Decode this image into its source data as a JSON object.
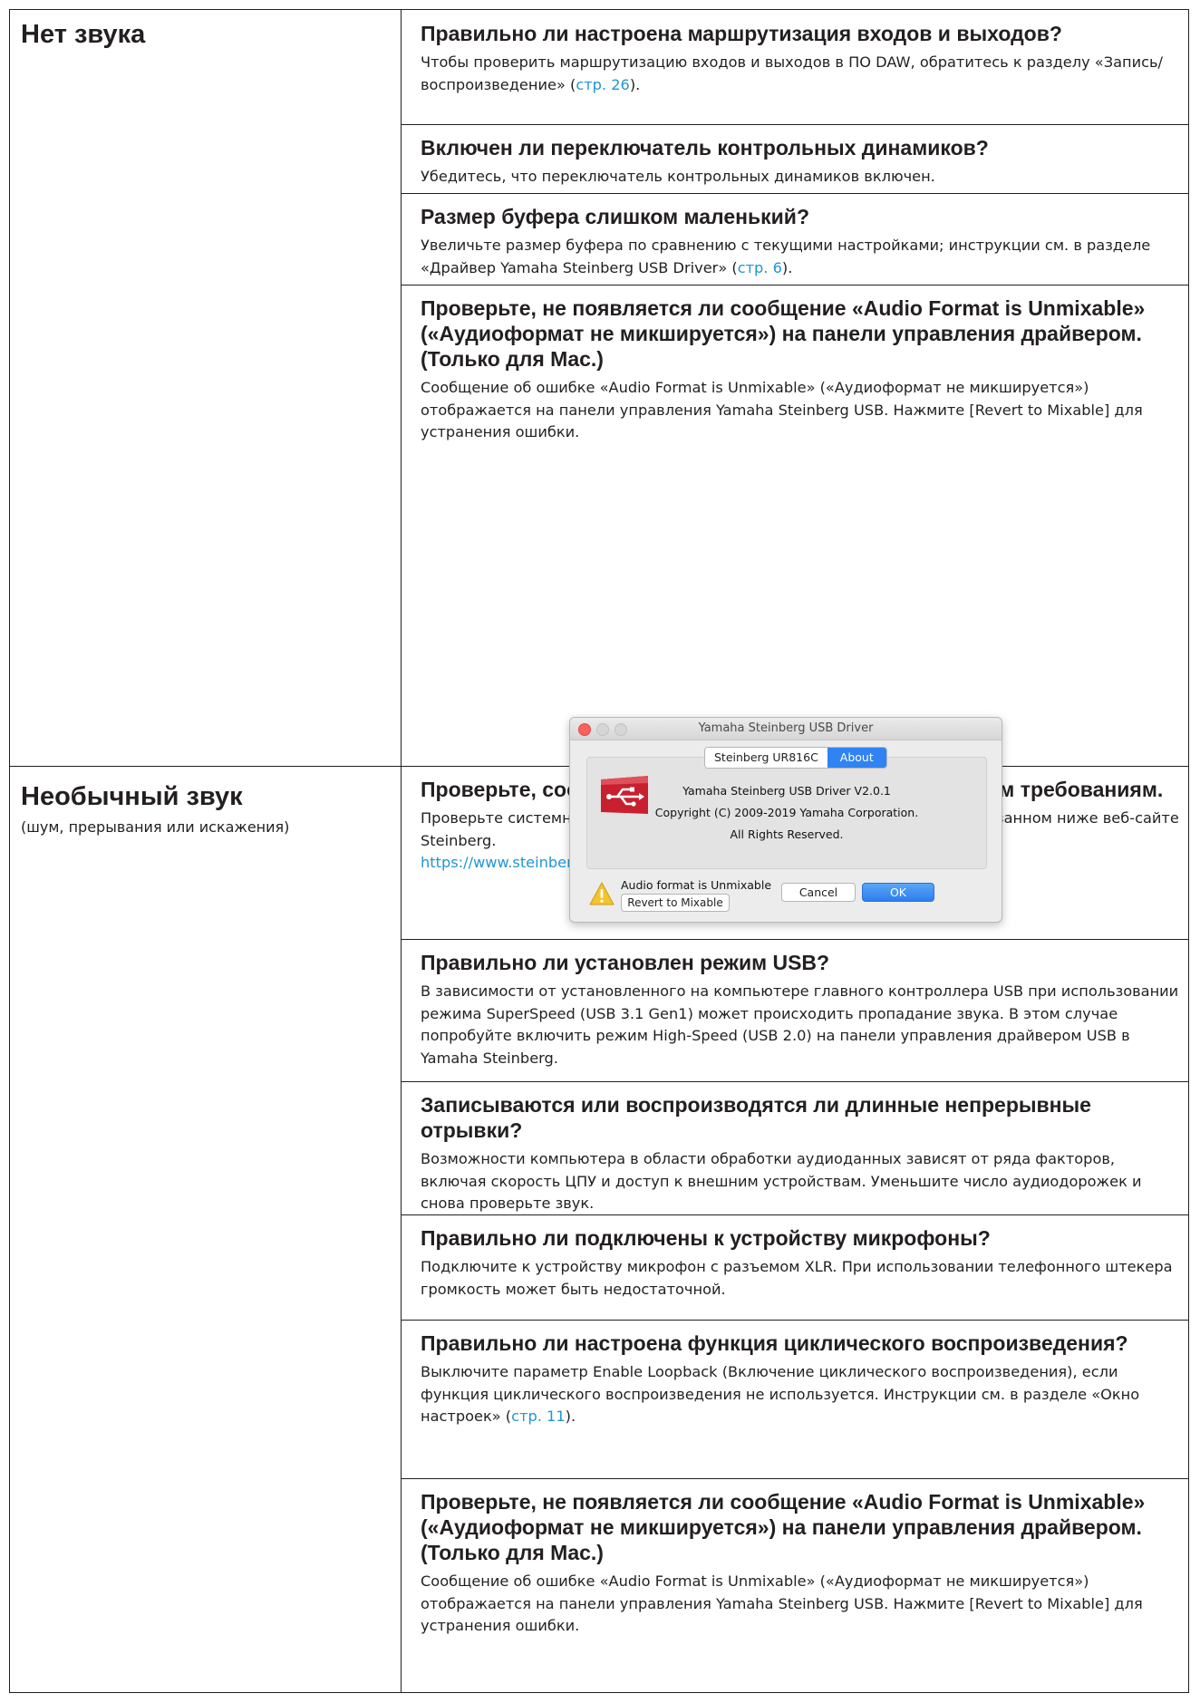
{
  "sections": [
    {
      "title": "Нет звука",
      "subtitle": ""
    },
    {
      "title": "Необычный звук",
      "subtitle": "(шум, прерывания или искажения)"
    }
  ],
  "no_sound": {
    "q1": {
      "title": "Правильно ли настроена маршрутизация входов и выходов?",
      "text_a": "Чтобы проверить маршрутизацию входов и выходов в ПО DAW, обратитесь к разделу «Запись/воспроизведение» (",
      "link": "стр. 26",
      "text_b": ")."
    },
    "q2": {
      "title": "Включен ли переключатель контрольных динамиков?",
      "text": "Убедитесь, что переключатель контрольных динамиков включен."
    },
    "q3": {
      "title": "Размер буфера слишком маленький?",
      "text_a": "Увеличьте размер буфера по сравнению с текущими настройками; инструкции см. в разделе «Драйвер Yamaha Steinberg USB Driver» (",
      "link": "стр. 6",
      "text_b": ")."
    },
    "q4": {
      "title": "Проверьте, не появляется ли сообщение «Audio Format is Unmixable» («Аудиоформат не микшируется») на панели управления драйвером. (Только для Mac.)",
      "text": "Сообщение об ошибке «Audio Format is Unmixable» («Аудиоформат не микшируется») отображается на панели управления Yamaha Steinberg USB. Нажмите [Revert to Mixable] для устранения ошибки."
    }
  },
  "dialog": {
    "window_title": "Yamaha Steinberg USB Driver",
    "tab_device": "Steinberg UR816C",
    "tab_about": "About",
    "about_line1": "Yamaha Steinberg USB Driver V2.0.1",
    "about_line2": "Copyright (C) 2009-2019 Yamaha Corporation.",
    "about_line3": "All Rights Reserved.",
    "warning_text": "Audio format is Unmixable",
    "revert_button": "Revert to Mixable",
    "cancel_button": "Cancel",
    "ok_button": "OK",
    "colors": {
      "accent": "#2f83f2",
      "close": "#fc605c",
      "usb_logo": "#c8202f",
      "warning": "#f5c32c"
    },
    "icons": [
      "usb-logo-icon",
      "warning-icon"
    ]
  },
  "unusual": {
    "q1": {
      "title": "Проверьте, соответствует ли ваш компьютер системным требованиям.",
      "text": "Проверьте системные требования. Самые последние сведения см. на указанном ниже веб-сайте Steinberg.",
      "url": "https://www.steinberg.net/"
    },
    "q2": {
      "title": "Правильно ли установлен режим USB?",
      "text": "В зависимости от установленного на компьютере главного контроллера USB при использовании режима SuperSpeed (USB 3.1 Gen1) может происходить пропадание звука. В этом случае попробуйте включить режим High-Speed (USB 2.0) на панели управления драйвером USB в Yamaha Steinberg."
    },
    "q3": {
      "title": "Записываются или воспроизводятся ли длинные непрерывные отрывки?",
      "text": "Возможности компьютера в области обработки аудиоданных зависят от ряда факторов, включая скорость ЦПУ и доступ к внешним устройствам. Уменьшите число аудиодорожек и снова проверьте звук."
    },
    "q4": {
      "title": "Правильно ли подключены к устройству микрофоны?",
      "text": "Подключите к устройству микрофон с разъемом XLR. При использовании телефонного штекера громкость может быть недостаточной."
    },
    "q5": {
      "title": "Правильно ли настроена функция циклического воспроизведения?",
      "text_a": "Выключите параметр Enable Loopback (Включение циклического воспроизведения), если функция циклического воспроизведения не используется. Инструкции см. в разделе «Окно настроек» (",
      "link": "стр. 11",
      "text_b": ")."
    },
    "q6": {
      "title": "Проверьте, не появляется ли сообщение «Audio Format is Unmixable» («Аудиоформат не микшируется») на панели управления драйвером. (Только для Mac.)",
      "text": "Сообщение об ошибке «Audio Format is Unmixable» («Аудиоформат не микшируется») отображается на панели управления Yamaha Steinberg USB. Нажмите [Revert to Mixable] для устранения ошибки."
    }
  },
  "link_color": "#2196d3"
}
